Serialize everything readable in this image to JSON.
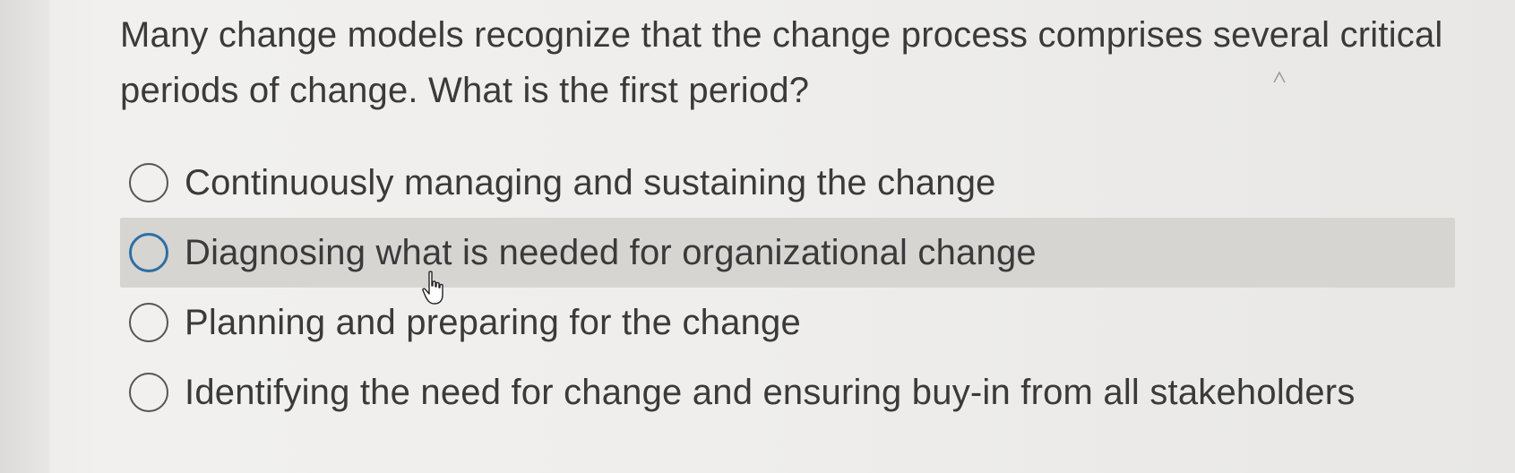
{
  "question": {
    "text": "Many change models recognize that the change process comprises several critical periods of change.  What is the first period?"
  },
  "options": [
    {
      "label": "Continuously managing and sustaining the change",
      "hovered": false
    },
    {
      "label": "Diagnosing what is needed for organizational change",
      "hovered": true
    },
    {
      "label": "Planning and preparing for the change",
      "hovered": false
    },
    {
      "label": "Identifying the need for change and ensuring buy-in from all stakeholders",
      "hovered": false
    }
  ],
  "icons": {
    "cursor": "hand-pointer-icon",
    "radio": "radio-circle-icon"
  },
  "colors": {
    "text": "#3a3a3a",
    "hover_background": "#d6d5d2",
    "hover_radio_border": "#2d6fa3",
    "radio_border": "#555555"
  }
}
